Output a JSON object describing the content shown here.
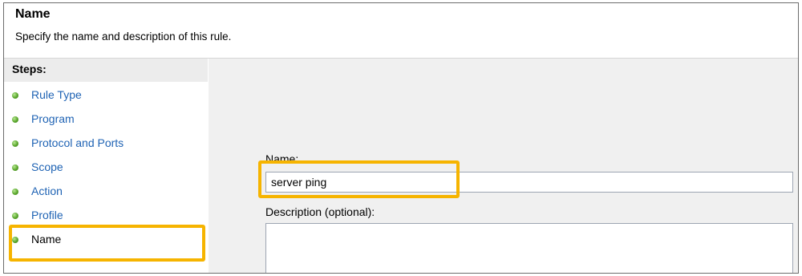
{
  "header": {
    "title": "Name",
    "description": "Specify the name and description of this rule."
  },
  "steps": {
    "label": "Steps:",
    "items": [
      {
        "label": "Rule Type"
      },
      {
        "label": "Program"
      },
      {
        "label": "Protocol and Ports"
      },
      {
        "label": "Scope"
      },
      {
        "label": "Action"
      },
      {
        "label": "Profile"
      },
      {
        "label": "Name"
      }
    ],
    "current": "Name"
  },
  "form": {
    "name_label": "Name:",
    "name_value": "server ping",
    "description_label": "Description (optional):",
    "description_value": ""
  },
  "colors": {
    "highlight": "#f6b400",
    "step_link": "#1f63b4",
    "step_bullet": "#5aa62c"
  }
}
